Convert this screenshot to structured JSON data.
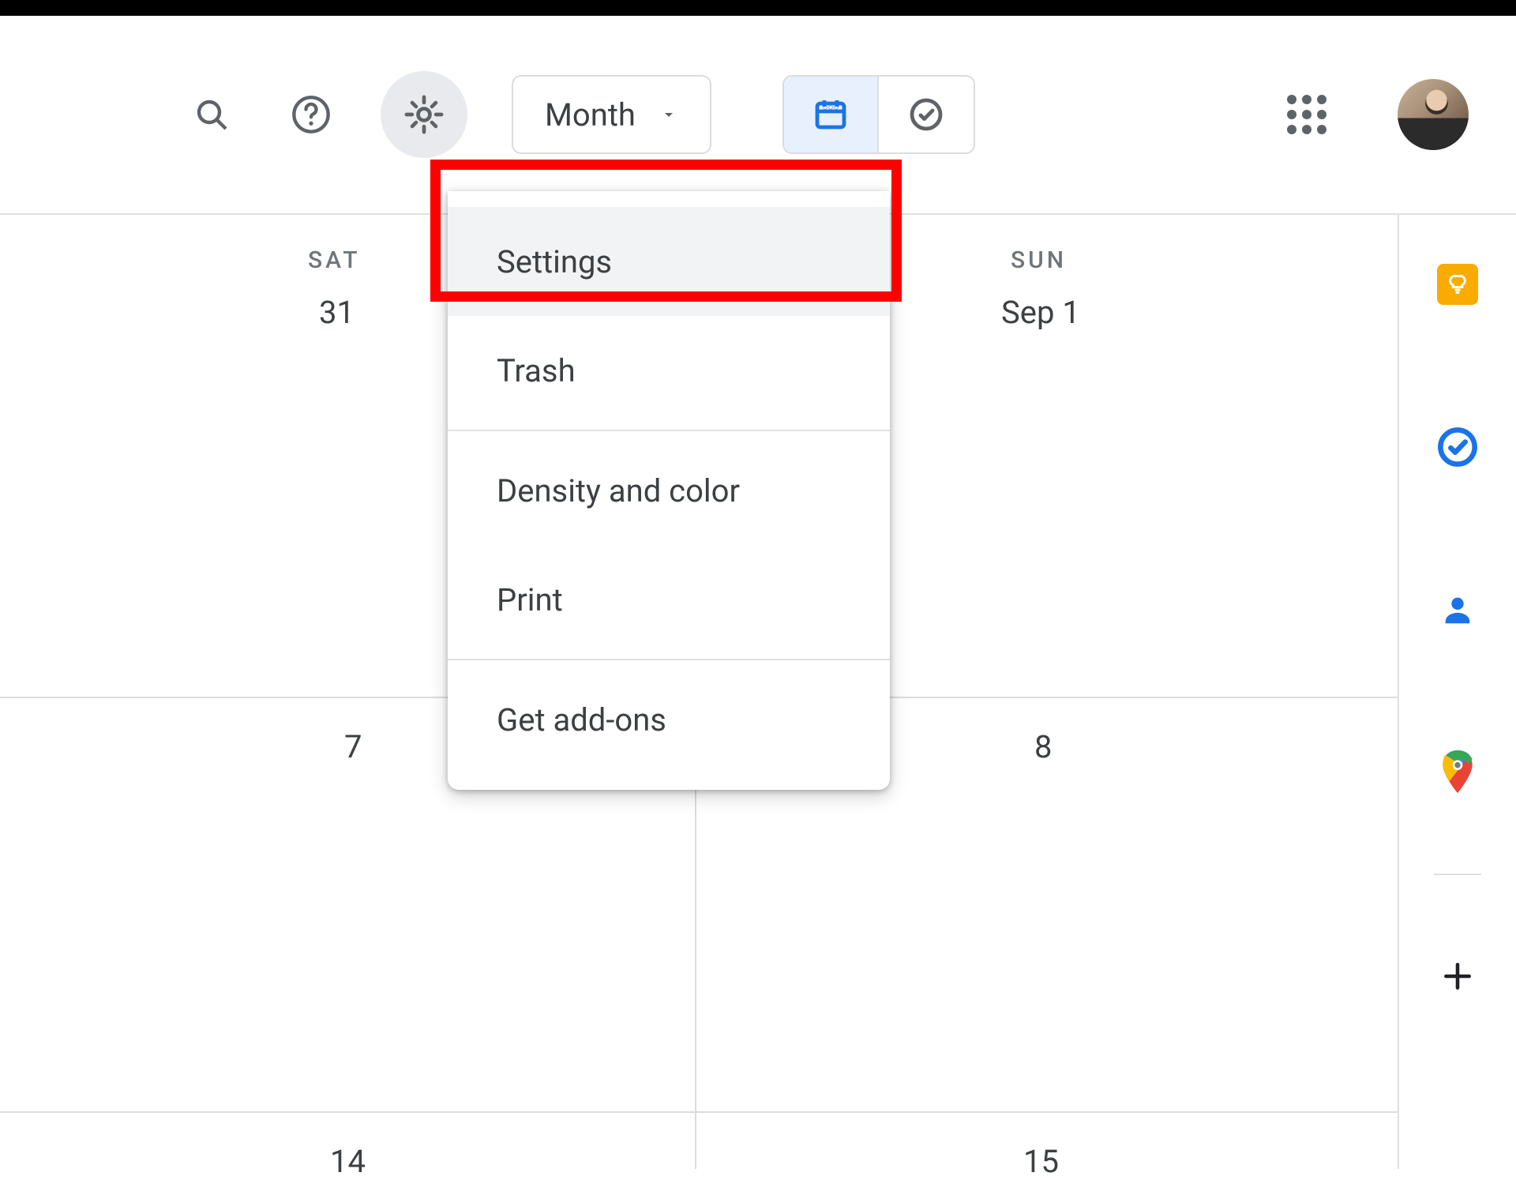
{
  "header": {
    "view_label": "Month",
    "segmented": {
      "calendar_selected": true
    }
  },
  "settings_menu": {
    "items": {
      "settings": "Settings",
      "trash": "Trash",
      "density": "Density and color",
      "print": "Print",
      "addons": "Get add-ons"
    },
    "highlighted": "settings"
  },
  "calendar_grid": {
    "day_headers": {
      "sat": "SAT",
      "sun": "SUN"
    },
    "cells": {
      "r0c0": "31",
      "r0c1": "Sep 1",
      "r1c0": "7",
      "r1c1": "8",
      "r2c0": "14",
      "r2c1": "15"
    }
  },
  "colors": {
    "google_blue": "#1a73e8",
    "keep_yellow": "#f9ab00",
    "tasks_blue": "#1a73e8",
    "contacts_blue": "#1a73e8"
  }
}
